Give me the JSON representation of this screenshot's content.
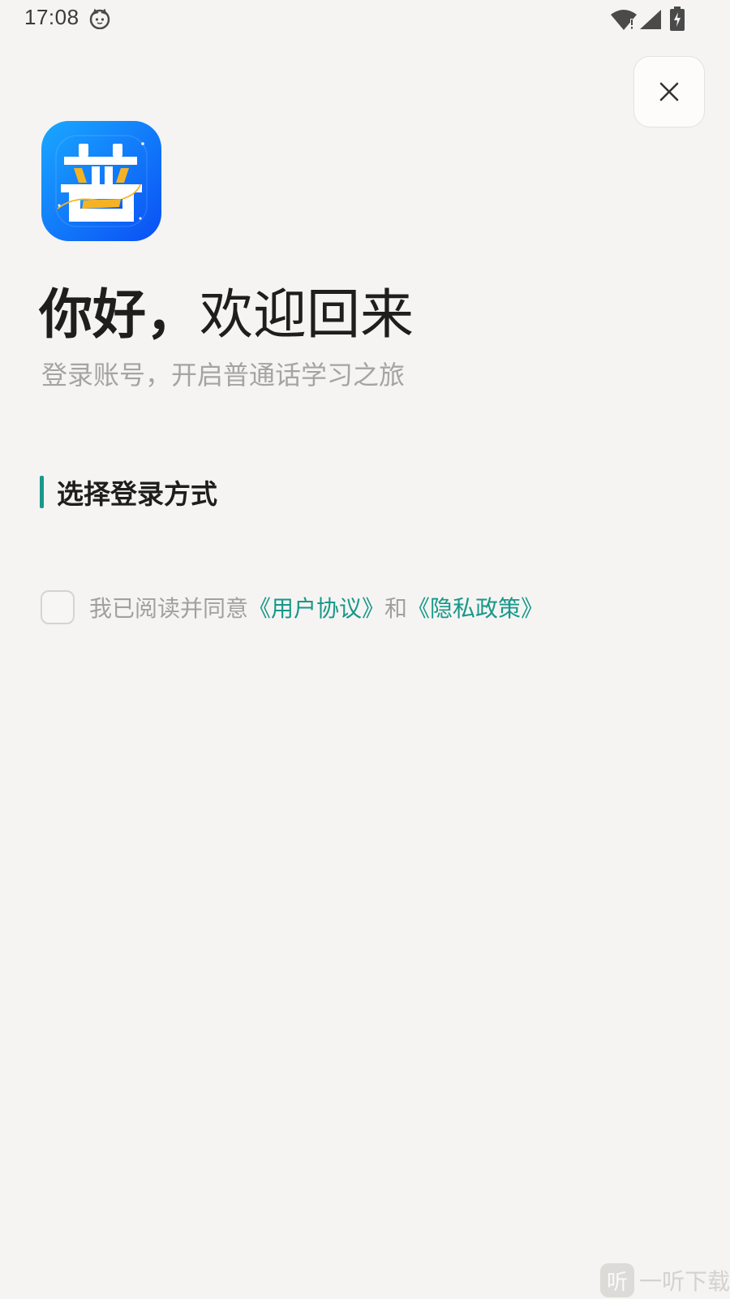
{
  "status_bar": {
    "time": "17:08",
    "icons": [
      "cat-notification-icon",
      "wifi-icon",
      "signal-icon",
      "battery-charging-icon"
    ]
  },
  "header": {
    "close_icon": "close-icon"
  },
  "app": {
    "logo_char": "普",
    "logo_gradient": [
      "#1aa8ff",
      "#0a4ff5"
    ],
    "accent_yellow": "#f5b324"
  },
  "greeting": {
    "bold_part": "你好，",
    "light_part": "欢迎回来"
  },
  "subtitle": "登录账号，开启普通话学习之旅",
  "section": {
    "title": "选择登录方式",
    "accent_color": "#17988a"
  },
  "agreement": {
    "prefix": "我已阅读并同意",
    "user_agreement": "《用户协议》",
    "connector": "和",
    "privacy_policy": "《隐私政策》",
    "checked": false
  },
  "watermark": {
    "icon_char": "听",
    "text": "一听下载"
  }
}
